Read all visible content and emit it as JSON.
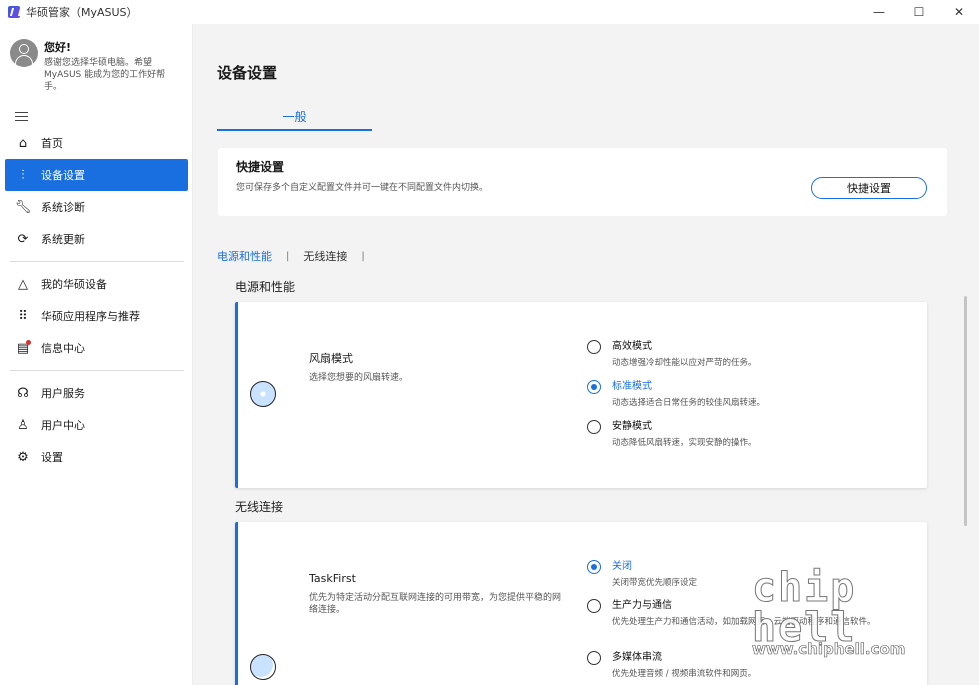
{
  "window": {
    "title": "华硕管家（MyASUS）",
    "controls": {
      "minimize": "—",
      "maximize": "☐",
      "close": "✕"
    }
  },
  "sidebar": {
    "greeting": "您好!",
    "greeting_sub": "感谢您选择华硕电脑。希望 MyASUS 能成为您的工作好帮手。",
    "items": [
      {
        "label": "首页",
        "icon": "home-icon"
      },
      {
        "label": "设备设置",
        "icon": "sliders-icon",
        "active": true
      },
      {
        "label": "系统诊断",
        "icon": "wrench-icon"
      },
      {
        "label": "系统更新",
        "icon": "update-icon"
      },
      {
        "label": "我的华硕设备",
        "icon": "devices-icon"
      },
      {
        "label": "华硕应用程序与推荐",
        "icon": "apps-grid-icon"
      },
      {
        "label": "信息中心",
        "icon": "message-icon"
      },
      {
        "label": "用户服务",
        "icon": "headset-icon"
      },
      {
        "label": "用户中心",
        "icon": "user-icon"
      },
      {
        "label": "设置",
        "icon": "gear-icon"
      }
    ]
  },
  "main": {
    "page_title": "设备设置",
    "tab_general": "一般",
    "quick": {
      "title": "快捷设置",
      "desc": "您可保存多个自定义配置文件并可一键在不同配置文件内切换。",
      "button": "快捷设置"
    },
    "subtabs": [
      "电源和性能",
      "无线连接"
    ],
    "sep": "|",
    "power_section": "电源和性能",
    "fan": {
      "title": "风扇模式",
      "desc": "选择您想要的风扇转速。",
      "options": [
        {
          "label": "高效模式",
          "desc": "动态增强冷却性能以应对严苛的任务。",
          "checked": false
        },
        {
          "label": "标准模式",
          "desc": "动态选择适合日常任务的较佳风扇转速。",
          "checked": true
        },
        {
          "label": "安静模式",
          "desc": "动态降低风扇转速，实现安静的操作。",
          "checked": false
        }
      ]
    },
    "wireless_section": "无线连接",
    "taskfirst": {
      "title": "TaskFirst",
      "desc": "优先为特定活动分配互联网连接的可用带宽，为您提供平稳的网络连接。",
      "options": [
        {
          "label": "关闭",
          "desc": "关闭带宽优先顺序设定",
          "checked": true
        },
        {
          "label": "生产力与通信",
          "desc": "优先处理生产力和通信活动，如加载网页，云端驱动程序和通信软件。",
          "checked": false
        },
        {
          "label": "多媒体串流",
          "desc": "优先处理音频 / 视频串流软件和网页。",
          "checked": false
        }
      ]
    }
  },
  "watermark": {
    "logo": "chip hell",
    "url": "www.chiphell.com"
  },
  "colors": {
    "accent": "#1a6fe0"
  }
}
